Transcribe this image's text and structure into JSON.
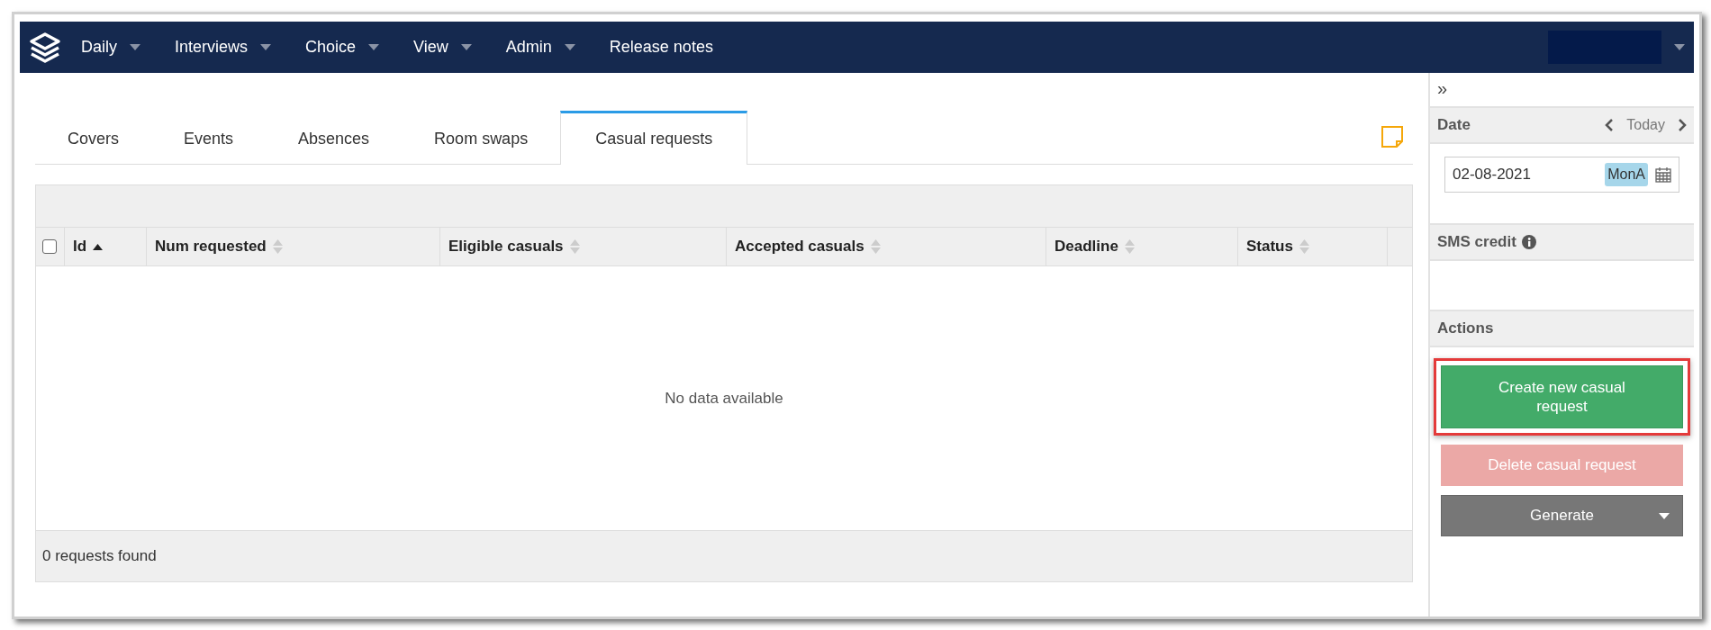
{
  "navbar": {
    "items": [
      {
        "label": "Daily",
        "has_dropdown": true
      },
      {
        "label": "Interviews",
        "has_dropdown": true
      },
      {
        "label": "Choice",
        "has_dropdown": true
      },
      {
        "label": "View",
        "has_dropdown": true
      },
      {
        "label": "Admin",
        "has_dropdown": true
      },
      {
        "label": "Release notes",
        "has_dropdown": false
      }
    ]
  },
  "tabs": [
    {
      "label": "Covers",
      "selected": false
    },
    {
      "label": "Events",
      "selected": false
    },
    {
      "label": "Absences",
      "selected": false
    },
    {
      "label": "Room swaps",
      "selected": false
    },
    {
      "label": "Casual requests",
      "selected": true
    }
  ],
  "table": {
    "select_all_checked": false,
    "columns": [
      {
        "label": "Id",
        "sorted": true
      },
      {
        "label": "Num requested",
        "sorted": false
      },
      {
        "label": "Eligible casuals",
        "sorted": false
      },
      {
        "label": "Accepted casuals",
        "sorted": false
      },
      {
        "label": "Deadline",
        "sorted": false
      },
      {
        "label": "Status",
        "sorted": false
      }
    ],
    "empty_message": "No data available",
    "footer": "0 requests found"
  },
  "sidebar": {
    "collapse": "»",
    "date": {
      "title": "Date",
      "today": "Today",
      "value": "02-08-2021",
      "badge": "MonA"
    },
    "sms": {
      "title": "SMS credit"
    },
    "actions": {
      "title": "Actions",
      "buttons": [
        {
          "label": "Create new casual request",
          "kind": "primary",
          "disabled": false,
          "highlighted": true
        },
        {
          "label": "Delete casual request",
          "kind": "danger",
          "disabled": true,
          "highlighted": false
        },
        {
          "label": "Generate",
          "kind": "dropdown",
          "disabled": false,
          "highlighted": false
        }
      ]
    }
  }
}
